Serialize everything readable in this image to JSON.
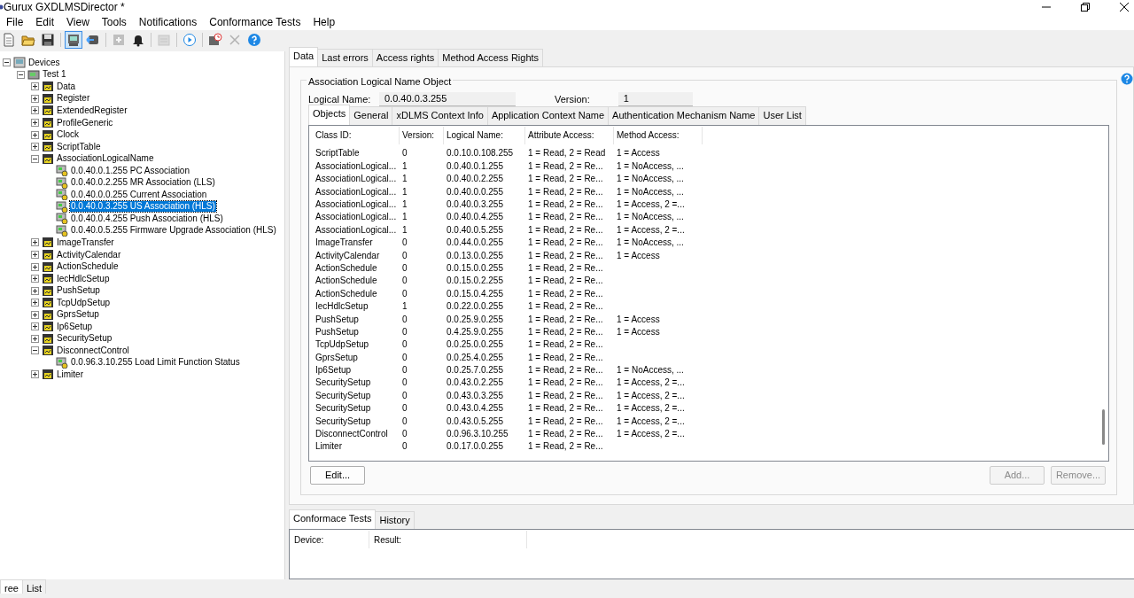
{
  "window": {
    "title": "Gurux GXDLMSDirector  *"
  },
  "menu": [
    "File",
    "Edit",
    "View",
    "Tools",
    "Notifications",
    "Conformance Tests",
    "Help"
  ],
  "toolbar": [
    {
      "pressed": false,
      "disabled": false
    },
    {
      "pressed": false,
      "disabled": false
    },
    {
      "pressed": false,
      "disabled": false
    },
    {
      "pressed": true,
      "disabled": false
    },
    {
      "pressed": false,
      "disabled": false
    },
    {
      "pressed": false,
      "disabled": true
    },
    {
      "pressed": false,
      "disabled": false
    },
    {
      "pressed": false,
      "disabled": true
    },
    {
      "pressed": false,
      "disabled": false
    },
    {
      "pressed": false,
      "disabled": false
    },
    {
      "pressed": false,
      "disabled": true
    },
    {
      "pressed": false,
      "disabled": false
    }
  ],
  "tree": [
    {
      "label": "Devices",
      "kind": "root",
      "expanded": true,
      "selected": false,
      "children": [
        {
          "label": "Test 1",
          "kind": "device",
          "expanded": true,
          "selected": false,
          "children": [
            {
              "label": "Data",
              "kind": "group",
              "expanded": false,
              "selected": false
            },
            {
              "label": "Register",
              "kind": "group",
              "expanded": false,
              "selected": false
            },
            {
              "label": "ExtendedRegister",
              "kind": "group",
              "expanded": false,
              "selected": false
            },
            {
              "label": "ProfileGeneric",
              "kind": "group",
              "expanded": false,
              "selected": false
            },
            {
              "label": "Clock",
              "kind": "group",
              "expanded": false,
              "selected": false
            },
            {
              "label": "ScriptTable",
              "kind": "group",
              "expanded": false,
              "selected": false
            },
            {
              "label": "AssociationLogicalName",
              "kind": "group",
              "expanded": true,
              "selected": false,
              "children": [
                {
                  "label": "0.0.40.0.1.255 PC Association",
                  "kind": "object",
                  "selected": false
                },
                {
                  "label": "0.0.40.0.2.255 MR Association (LLS)",
                  "kind": "object",
                  "selected": false
                },
                {
                  "label": "0.0.40.0.0.255 Current Association",
                  "kind": "object",
                  "selected": false
                },
                {
                  "label": "0.0.40.0.3.255 US Association (HLS)",
                  "kind": "object",
                  "selected": true
                },
                {
                  "label": "0.0.40.0.4.255 Push Association (HLS)",
                  "kind": "object",
                  "selected": false
                },
                {
                  "label": "0.0.40.0.5.255 Firmware Upgrade Association (HLS)",
                  "kind": "object",
                  "selected": false
                }
              ]
            },
            {
              "label": "ImageTransfer",
              "kind": "group",
              "expanded": false,
              "selected": false
            },
            {
              "label": "ActivityCalendar",
              "kind": "group",
              "expanded": false,
              "selected": false
            },
            {
              "label": "ActionSchedule",
              "kind": "group",
              "expanded": false,
              "selected": false
            },
            {
              "label": "IecHdlcSetup",
              "kind": "group",
              "expanded": false,
              "selected": false
            },
            {
              "label": "PushSetup",
              "kind": "group",
              "expanded": false,
              "selected": false
            },
            {
              "label": "TcpUdpSetup",
              "kind": "group",
              "expanded": false,
              "selected": false
            },
            {
              "label": "GprsSetup",
              "kind": "group",
              "expanded": false,
              "selected": false
            },
            {
              "label": "Ip6Setup",
              "kind": "group",
              "expanded": false,
              "selected": false
            },
            {
              "label": "SecuritySetup",
              "kind": "group",
              "expanded": false,
              "selected": false
            },
            {
              "label": "DisconnectControl",
              "kind": "group",
              "expanded": true,
              "selected": false,
              "children": [
                {
                  "label": "0.0.96.3.10.255 Load Limit Function Status",
                  "kind": "object",
                  "selected": false
                }
              ]
            },
            {
              "label": "Limiter",
              "kind": "group",
              "expanded": false,
              "selected": false
            }
          ]
        }
      ]
    }
  ],
  "left_tabs": [
    {
      "label": "ree",
      "selected": true
    },
    {
      "label": "List",
      "selected": false
    }
  ],
  "tabs": [
    {
      "label": "Data",
      "selected": true
    },
    {
      "label": "Last errors",
      "selected": false
    },
    {
      "label": "Access rights",
      "selected": false
    },
    {
      "label": "Method Access Rights",
      "selected": false
    }
  ],
  "group_title": "Association Logical  Name Object",
  "logical_name": {
    "label": "Logical Name:",
    "value": "0.0.40.0.3.255"
  },
  "version": {
    "label": "Version:",
    "value": "1"
  },
  "inner_tabs": [
    {
      "label": "Objects",
      "selected": true
    },
    {
      "label": "General",
      "selected": false
    },
    {
      "label": "xDLMS Context Info",
      "selected": false
    },
    {
      "label": "Application Context Name",
      "selected": false
    },
    {
      "label": "Authentication Mechanism Name",
      "selected": false
    },
    {
      "label": "User List",
      "selected": false
    }
  ],
  "table": {
    "columns": [
      "Class ID:",
      "Version:",
      "Logical Name:",
      "Attribute Access:",
      "Method Access:"
    ],
    "rows": [
      [
        "ScriptTable",
        "0",
        "0.0.10.0.108.255",
        "1 = Read, 2 = Read",
        "1 = Access"
      ],
      [
        "AssociationLogical...",
        "1",
        "0.0.40.0.1.255",
        "1 = Read, 2 = Re...",
        "1 = NoAccess, ..."
      ],
      [
        "AssociationLogical...",
        "1",
        "0.0.40.0.2.255",
        "1 = Read, 2 = Re...",
        "1 = NoAccess, ..."
      ],
      [
        "AssociationLogical...",
        "1",
        "0.0.40.0.0.255",
        "1 = Read, 2 = Re...",
        "1 = NoAccess, ..."
      ],
      [
        "AssociationLogical...",
        "1",
        "0.0.40.0.3.255",
        "1 = Read, 2 = Re...",
        "1 = Access, 2 =..."
      ],
      [
        "AssociationLogical...",
        "1",
        "0.0.40.0.4.255",
        "1 = Read, 2 = Re...",
        "1 = NoAccess, ..."
      ],
      [
        "AssociationLogical...",
        "1",
        "0.0.40.0.5.255",
        "1 = Read, 2 = Re...",
        "1 = Access, 2 =..."
      ],
      [
        "ImageTransfer",
        "0",
        "0.0.44.0.0.255",
        "1 = Read, 2 = Re...",
        "1 = NoAccess, ..."
      ],
      [
        "ActivityCalendar",
        "0",
        "0.0.13.0.0.255",
        "1 = Read, 2 = Re...",
        "1 = Access"
      ],
      [
        "ActionSchedule",
        "0",
        "0.0.15.0.0.255",
        "1 = Read, 2 = Re...",
        ""
      ],
      [
        "ActionSchedule",
        "0",
        "0.0.15.0.2.255",
        "1 = Read, 2 = Re...",
        ""
      ],
      [
        "ActionSchedule",
        "0",
        "0.0.15.0.4.255",
        "1 = Read, 2 = Re...",
        ""
      ],
      [
        "IecHdlcSetup",
        "1",
        "0.0.22.0.0.255",
        "1 = Read, 2 = Re...",
        ""
      ],
      [
        "PushSetup",
        "0",
        "0.0.25.9.0.255",
        "1 = Read, 2 = Re...",
        "1 = Access"
      ],
      [
        "PushSetup",
        "0",
        "0.4.25.9.0.255",
        "1 = Read, 2 = Re...",
        "1 = Access"
      ],
      [
        "TcpUdpSetup",
        "0",
        "0.0.25.0.0.255",
        "1 = Read, 2 = Re...",
        ""
      ],
      [
        "GprsSetup",
        "0",
        "0.0.25.4.0.255",
        "1 = Read, 2 = Re...",
        ""
      ],
      [
        "Ip6Setup",
        "0",
        "0.0.25.7.0.255",
        "1 = Read, 2 = Re...",
        "1 = NoAccess, ..."
      ],
      [
        "SecuritySetup",
        "0",
        "0.0.43.0.2.255",
        "1 = Read, 2 = Re...",
        "1 = Access, 2 =..."
      ],
      [
        "SecuritySetup",
        "0",
        "0.0.43.0.3.255",
        "1 = Read, 2 = Re...",
        "1 = Access, 2 =..."
      ],
      [
        "SecuritySetup",
        "0",
        "0.0.43.0.4.255",
        "1 = Read, 2 = Re...",
        "1 = Access, 2 =..."
      ],
      [
        "SecuritySetup",
        "0",
        "0.0.43.0.5.255",
        "1 = Read, 2 = Re...",
        "1 = Access, 2 =..."
      ],
      [
        "DisconnectControl",
        "0",
        "0.0.96.3.10.255",
        "1 = Read, 2 = Re...",
        "1 = Access, 2 =..."
      ],
      [
        "Limiter",
        "0",
        "0.0.17.0.0.255",
        "1 = Read, 2 = Re...",
        ""
      ]
    ]
  },
  "buttons": [
    {
      "label": "Edit...",
      "disabled": false
    },
    {
      "label": "Add...",
      "disabled": true
    },
    {
      "label": "Remove...",
      "disabled": true
    }
  ],
  "bottom_tabs": [
    {
      "label": "Conformace Tests",
      "selected": true
    },
    {
      "label": "History",
      "selected": false
    }
  ],
  "results_columns": [
    "Device:",
    "Result:"
  ]
}
